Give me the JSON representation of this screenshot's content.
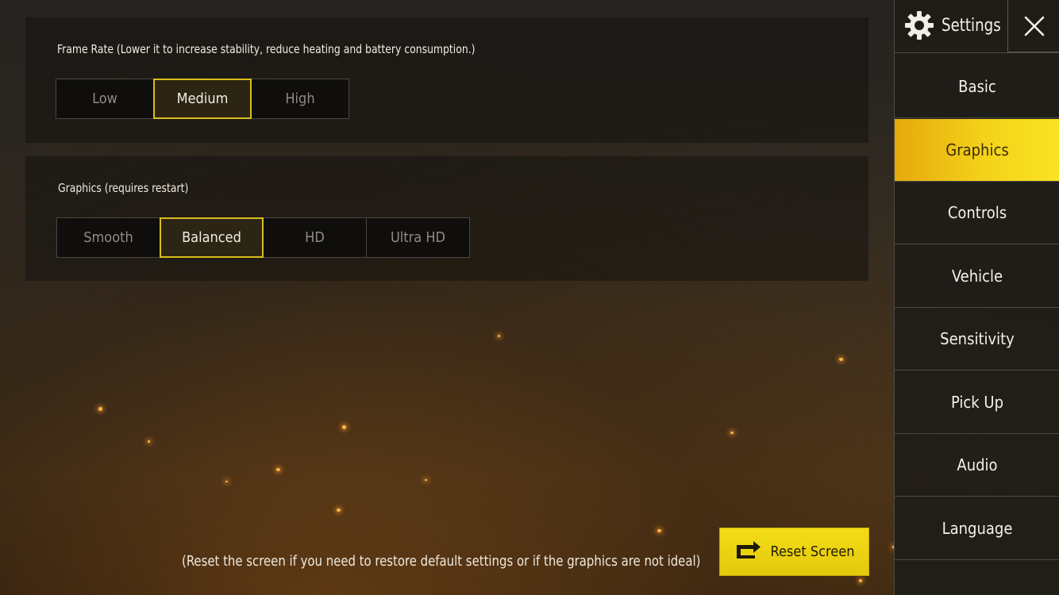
{
  "frame_rate": {
    "label": "Frame Rate (Lower it to increase stability, reduce heating and battery consumption.)",
    "options": [
      "Low",
      "Medium",
      "High"
    ],
    "selected": "Medium"
  },
  "graphics": {
    "label": "Graphics (requires restart)",
    "options": [
      "Smooth",
      "Balanced",
      "HD",
      "Ultra HD"
    ],
    "selected": "Balanced"
  },
  "footer": {
    "hint": "(Reset the screen if you need to restore default settings or if the graphics are not ideal)",
    "reset_label": "Reset Screen"
  },
  "sidebar": {
    "title": "Settings",
    "items": [
      {
        "label": "Basic"
      },
      {
        "label": "Graphics"
      },
      {
        "label": "Controls"
      },
      {
        "label": "Vehicle"
      },
      {
        "label": "Sensitivity"
      },
      {
        "label": "Pick Up"
      },
      {
        "label": "Audio"
      },
      {
        "label": "Language"
      }
    ],
    "active": "Graphics"
  },
  "icons": {
    "settings": "gear-icon",
    "close": "close-icon",
    "reset": "reset-icon"
  },
  "colors": {
    "accent_yellow": "#f3dd16",
    "active_tab_start": "#e6a90c",
    "selected_border": "#d9bd1c"
  }
}
